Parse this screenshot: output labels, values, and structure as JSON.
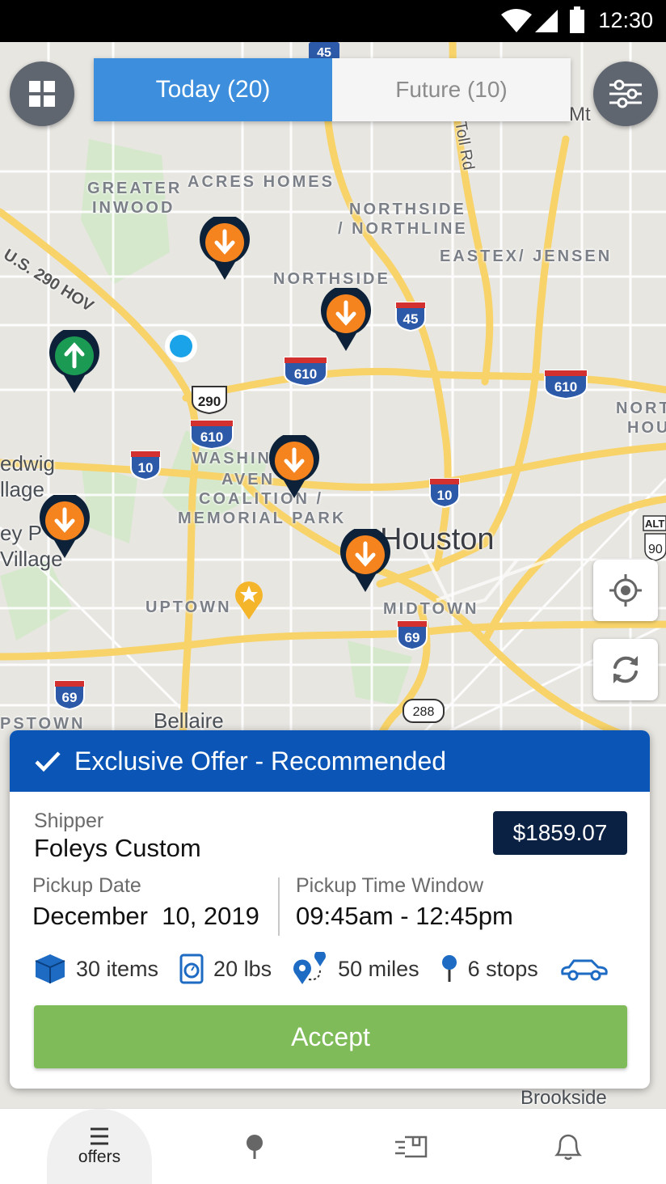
{
  "status_bar": {
    "time": "12:30"
  },
  "tabs": {
    "today": "Today (20)",
    "future": "Future (10)"
  },
  "map": {
    "neighborhoods": [
      "GREATER",
      "INWOOD",
      "ACRES HOMES",
      "NORTHSIDE",
      "/ NORTHLINE",
      "EASTEX/ JENSEN",
      "NORTHSIDE",
      "WASHIN",
      "AVEN",
      "COALITION /",
      "MEMORIAL PARK",
      "UPTOWN",
      "MIDTOWN",
      "NORT",
      "HOU",
      "PSTOWN"
    ],
    "cities": [
      "Houston",
      "Bellaire",
      "Brookside",
      "edwig",
      "llage",
      "ey P",
      "Village"
    ],
    "roads": [
      "U.S. 290 HOV",
      "Toll Rd",
      "Mt"
    ],
    "shields": [
      "45",
      "45",
      "610",
      "610",
      "290",
      "610",
      "10",
      "10",
      "69",
      "69",
      "288",
      "ALT",
      "90"
    ]
  },
  "offer": {
    "header": "Exclusive Offer - Recommended",
    "shipper_label": "Shipper",
    "shipper": "Foleys Custom",
    "price": "$1859.07",
    "pickup_date_label": "Pickup Date",
    "pickup_date": "December  10, 2019",
    "pickup_window_label": "Pickup Time Window",
    "pickup_window": "09:45am - 12:45pm",
    "items": "30 items",
    "weight": "20 lbs",
    "distance": "50 miles",
    "stops": "6 stops",
    "accept": "Accept"
  },
  "nav": {
    "offers": "offers"
  },
  "colors": {
    "accent": "#3d8edc",
    "header": "#0a55b5",
    "accept": "#80bb5a",
    "pin_orange": "#f5841f",
    "pin_green": "#1a9a52"
  }
}
